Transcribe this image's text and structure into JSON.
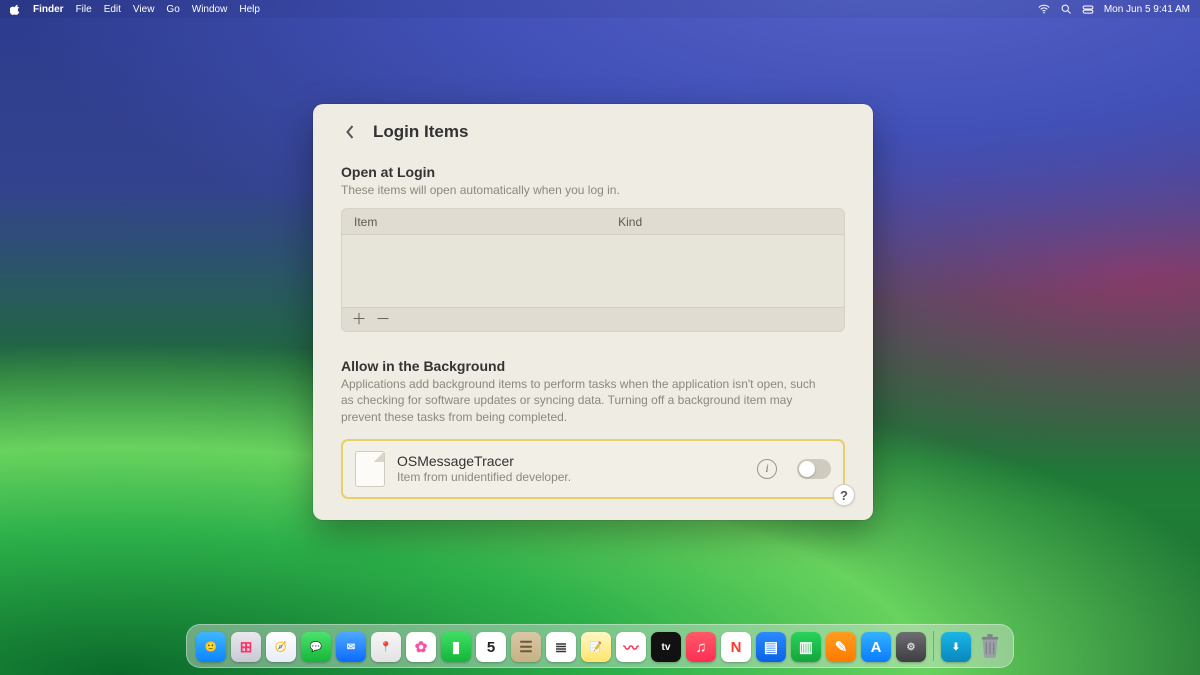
{
  "menubar": {
    "app": "Finder",
    "items": [
      "File",
      "Edit",
      "View",
      "Go",
      "Window",
      "Help"
    ],
    "clock": "Mon Jun 5  9:41 AM"
  },
  "window": {
    "title": "Login Items",
    "open_at_login": {
      "heading": "Open at Login",
      "description": "These items will open automatically when you log in.",
      "columns": {
        "item": "Item",
        "kind": "Kind"
      }
    },
    "allow_bg": {
      "heading": "Allow in the Background",
      "description": "Applications add background items to perform tasks when the application isn't open, such as checking for software updates or syncing data. Turning off a background item may prevent these tasks from being completed."
    },
    "bg_items": [
      {
        "name": "OSMessageTracer",
        "subtitle": "Item from unidentified developer.",
        "enabled": false
      }
    ],
    "help_label": "?"
  },
  "dock": {
    "apps": [
      {
        "id": "finder",
        "bg": "linear-gradient(180deg,#3fb7ff,#0a84ff)",
        "glyph": "🙂",
        "fg": "#fff"
      },
      {
        "id": "launchpad",
        "bg": "linear-gradient(180deg,#e8e8ee,#c9c9d3)",
        "glyph": "⊞",
        "fg": "#ff3366"
      },
      {
        "id": "safari",
        "bg": "linear-gradient(180deg,#ffffff,#e7ecf5)",
        "glyph": "🧭",
        "fg": "#0b62ff"
      },
      {
        "id": "messages",
        "bg": "linear-gradient(180deg,#4be36b,#16b53a)",
        "glyph": "💬",
        "fg": "#fff"
      },
      {
        "id": "mail",
        "bg": "linear-gradient(180deg,#4ea8ff,#0a6bff)",
        "glyph": "✉︎",
        "fg": "#fff"
      },
      {
        "id": "maps",
        "bg": "linear-gradient(180deg,#f6f6f6,#e3e3e3)",
        "glyph": "📍",
        "fg": "#0a84ff"
      },
      {
        "id": "photos",
        "bg": "#ffffff",
        "glyph": "✿",
        "fg": "#ff4fa3"
      },
      {
        "id": "facetime",
        "bg": "linear-gradient(180deg,#3fdf63,#13b63a)",
        "glyph": "▮",
        "fg": "#fff"
      },
      {
        "id": "calendar",
        "bg": "#ffffff",
        "glyph": "5",
        "fg": "#222"
      },
      {
        "id": "contacts",
        "bg": "linear-gradient(180deg,#d9c7a6,#c7b184)",
        "glyph": "☰",
        "fg": "#6a5a3a"
      },
      {
        "id": "reminders",
        "bg": "#ffffff",
        "glyph": "≣",
        "fg": "#333"
      },
      {
        "id": "notes",
        "bg": "linear-gradient(180deg,#fff7c2,#ffe56b)",
        "glyph": "📝",
        "fg": "#9a7b00"
      },
      {
        "id": "freeform",
        "bg": "#ffffff",
        "glyph": "〰",
        "fg": "#ff2d55"
      },
      {
        "id": "tv",
        "bg": "#111111",
        "glyph": "tv",
        "fg": "#fff"
      },
      {
        "id": "music",
        "bg": "linear-gradient(180deg,#ff5a68,#ff2d55)",
        "glyph": "♫",
        "fg": "#fff"
      },
      {
        "id": "news",
        "bg": "#ffffff",
        "glyph": "N",
        "fg": "#ff3b30"
      },
      {
        "id": "keynote",
        "bg": "linear-gradient(180deg,#2b8bff,#0a62e6)",
        "glyph": "▤",
        "fg": "#fff"
      },
      {
        "id": "numbers",
        "bg": "linear-gradient(180deg,#29d35a,#12a53b)",
        "glyph": "▥",
        "fg": "#fff"
      },
      {
        "id": "pages",
        "bg": "linear-gradient(180deg,#ff9d1f,#ff7a00)",
        "glyph": "✎",
        "fg": "#fff"
      },
      {
        "id": "appstore",
        "bg": "linear-gradient(180deg,#33b2ff,#0a7bff)",
        "glyph": "A",
        "fg": "#fff"
      },
      {
        "id": "settings",
        "bg": "linear-gradient(180deg,#6d6d72,#3e3e42)",
        "glyph": "⚙︎",
        "fg": "#dcdce0"
      }
    ],
    "right": [
      {
        "id": "downloads",
        "bg": "linear-gradient(180deg,#18b6e6,#0a87bd)",
        "glyph": "⬇︎",
        "fg": "#fff"
      }
    ]
  }
}
